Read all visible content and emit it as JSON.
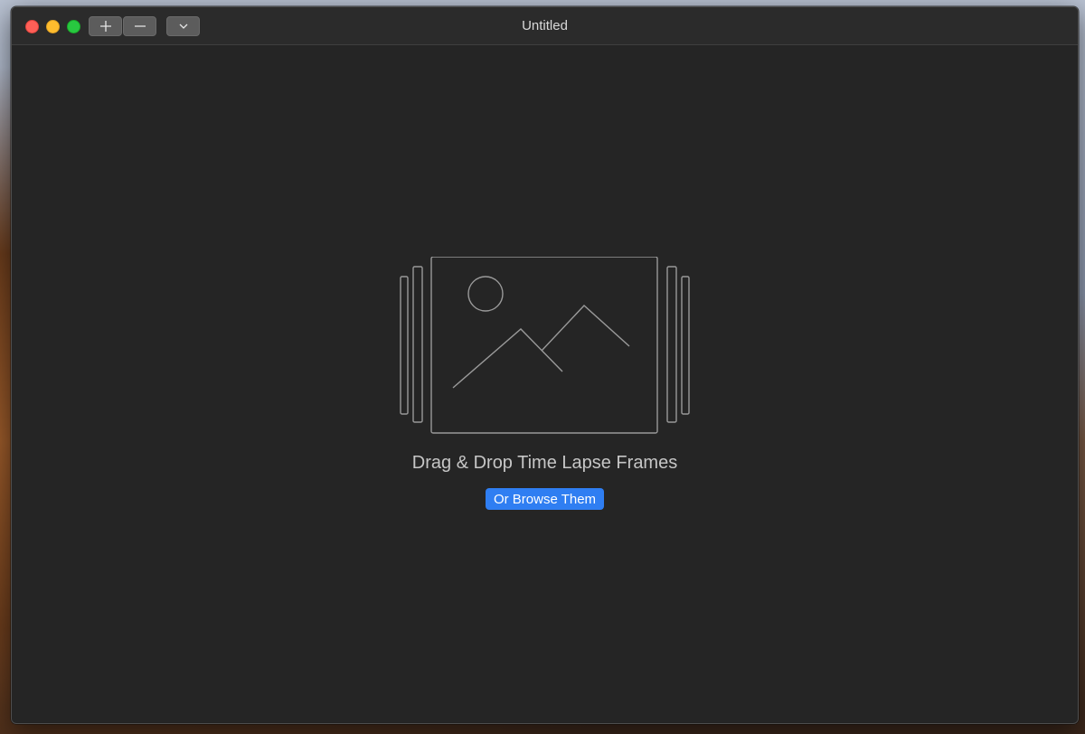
{
  "window": {
    "title": "Untitled"
  },
  "toolbar": {
    "add_icon": "plus-icon",
    "remove_icon": "minus-icon",
    "menu_icon": "chevron-down-icon"
  },
  "main": {
    "illustration_icon": "image-frames-icon",
    "drop_label": "Drag & Drop Time Lapse Frames",
    "browse_label": "Or Browse Them"
  },
  "colors": {
    "window_bg": "#252525",
    "accent": "#2f7ef2",
    "close": "#fe5f57",
    "minimize": "#febc2e",
    "zoom": "#28c840"
  }
}
